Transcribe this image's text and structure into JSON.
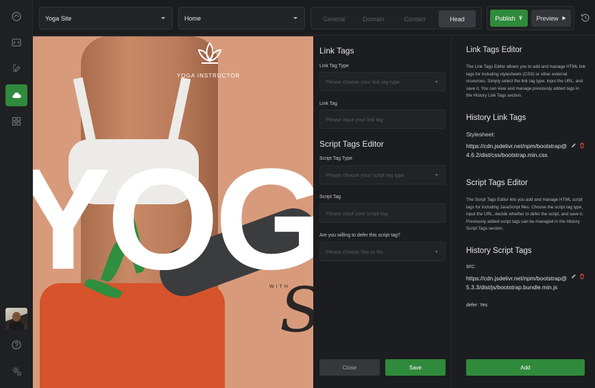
{
  "topbar": {
    "site_select": "Yoga Site",
    "page_select": "Home",
    "tabs": [
      {
        "label": "General"
      },
      {
        "label": "Domain"
      },
      {
        "label": "Contact"
      },
      {
        "label": "Head"
      }
    ],
    "active_tab": "Head",
    "publish_label": "Publish",
    "preview_label": "Preview"
  },
  "canvas": {
    "brand_name": "YOGA INSTRUCTOR",
    "big_text": "YOG",
    "with_text": "WITH",
    "script_text": "Sa"
  },
  "head_form": {
    "link_tags": {
      "title": "Link Tags",
      "type_label": "Link Tag Type",
      "type_placeholder": "Please choose your link tag type",
      "tag_label": "Link Tag",
      "tag_placeholder": "Please input your link tag"
    },
    "script_tags": {
      "title": "Script Tags Editor",
      "type_label": "Script Tag Type",
      "type_placeholder": "Please choose your script tag type",
      "tag_label": "Script Tag",
      "tag_placeholder": "Please input your script tag",
      "defer_label": "Are you willing to defer this script tag?",
      "defer_placeholder": "Please choose Yes or No"
    },
    "close_label": "Close",
    "save_label": "Save"
  },
  "editor_info": {
    "link_editor_title": "Link Tags Editor",
    "link_editor_desc": "The Link Tags Editor allows you to add and manage HTML link tags for including stylesheets (CSS) or other external resources. Simply select the link tag type, input the URL, and save it. You can view and manage previously added tags in the History Link Tags section.",
    "history_link_title": "History Link Tags",
    "link_entry": {
      "type": "Stylesheet:",
      "url": "https://cdn.jsdelivr.net/npm/bootstrap@4.6.2/dist/css/bootstrap.min.css"
    },
    "script_editor_title": "Script Tags Editor",
    "script_editor_desc": "The Script Tags Editor lets you add and manage HTML script tags for including JavaScript files. Choose the script tag type, input the URL, decide whether to defer the script, and save it. Previously added script tags can be managed in the History Script Tags section.",
    "history_script_title": "History Script Tags",
    "script_entry": {
      "type": "src:",
      "url": "https://cdn.jsdelivr.net/npm/bootstrap@5.3.3/dist/js/bootstrap.bundle.min.js",
      "defer": "defer: Yes"
    },
    "add_label": "Add"
  },
  "colors": {
    "accent_green": "#2f8a3b",
    "background": "#1b1c1e",
    "delete_red": "#d9473f"
  }
}
